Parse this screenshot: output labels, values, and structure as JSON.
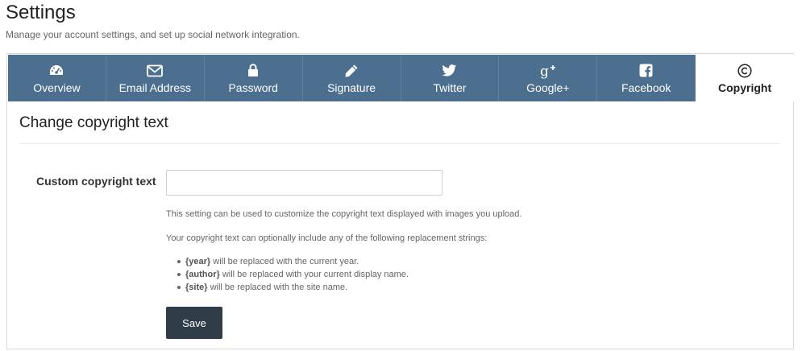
{
  "header": {
    "title": "Settings",
    "subtitle": "Manage your account settings, and set up social network integration."
  },
  "tabs": [
    {
      "label": "Overview",
      "icon": "dashboard-icon",
      "active": false
    },
    {
      "label": "Email Address",
      "icon": "envelope-icon",
      "active": false
    },
    {
      "label": "Password",
      "icon": "lock-icon",
      "active": false
    },
    {
      "label": "Signature",
      "icon": "pencil-icon",
      "active": false
    },
    {
      "label": "Twitter",
      "icon": "twitter-icon",
      "active": false
    },
    {
      "label": "Google+",
      "icon": "google-plus-icon",
      "active": false
    },
    {
      "label": "Facebook",
      "icon": "facebook-icon",
      "active": false
    },
    {
      "label": "Copyright",
      "icon": "copyright-icon",
      "active": true
    }
  ],
  "section": {
    "title": "Change copyright text"
  },
  "form": {
    "field_label": "Custom copyright text",
    "field_value": "",
    "help_text": "This setting can be used to customize the copyright text displayed with images you upload.",
    "help_text_2": "Your copyright text can optionally include any of the following replacement strings:",
    "replacements": [
      {
        "token": "{year}",
        "description": " will be replaced with the current year."
      },
      {
        "token": "{author}",
        "description": " will be replaced with your current display name."
      },
      {
        "token": "{site}",
        "description": " will be replaced with the site name."
      }
    ],
    "save_label": "Save"
  },
  "colors": {
    "tab_bg": "#4d6f8f",
    "button_bg": "#2e3d47"
  }
}
